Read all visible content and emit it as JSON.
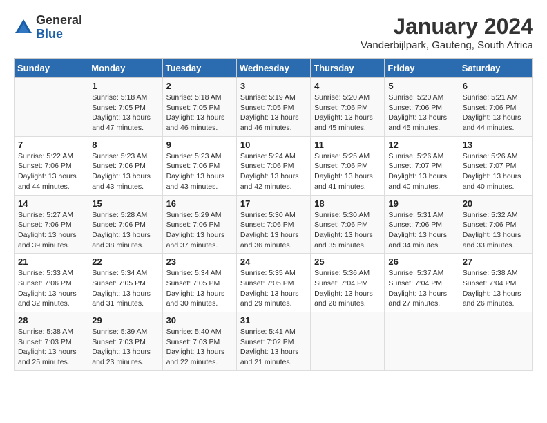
{
  "header": {
    "logo_general": "General",
    "logo_blue": "Blue",
    "month_title": "January 2024",
    "location": "Vanderbijlpark, Gauteng, South Africa"
  },
  "days_of_week": [
    "Sunday",
    "Monday",
    "Tuesday",
    "Wednesday",
    "Thursday",
    "Friday",
    "Saturday"
  ],
  "weeks": [
    [
      {
        "day": "",
        "info": ""
      },
      {
        "day": "1",
        "info": "Sunrise: 5:18 AM\nSunset: 7:05 PM\nDaylight: 13 hours and 47 minutes."
      },
      {
        "day": "2",
        "info": "Sunrise: 5:18 AM\nSunset: 7:05 PM\nDaylight: 13 hours and 46 minutes."
      },
      {
        "day": "3",
        "info": "Sunrise: 5:19 AM\nSunset: 7:05 PM\nDaylight: 13 hours and 46 minutes."
      },
      {
        "day": "4",
        "info": "Sunrise: 5:20 AM\nSunset: 7:06 PM\nDaylight: 13 hours and 45 minutes."
      },
      {
        "day": "5",
        "info": "Sunrise: 5:20 AM\nSunset: 7:06 PM\nDaylight: 13 hours and 45 minutes."
      },
      {
        "day": "6",
        "info": "Sunrise: 5:21 AM\nSunset: 7:06 PM\nDaylight: 13 hours and 44 minutes."
      }
    ],
    [
      {
        "day": "7",
        "info": "Sunrise: 5:22 AM\nSunset: 7:06 PM\nDaylight: 13 hours and 44 minutes."
      },
      {
        "day": "8",
        "info": "Sunrise: 5:23 AM\nSunset: 7:06 PM\nDaylight: 13 hours and 43 minutes."
      },
      {
        "day": "9",
        "info": "Sunrise: 5:23 AM\nSunset: 7:06 PM\nDaylight: 13 hours and 43 minutes."
      },
      {
        "day": "10",
        "info": "Sunrise: 5:24 AM\nSunset: 7:06 PM\nDaylight: 13 hours and 42 minutes."
      },
      {
        "day": "11",
        "info": "Sunrise: 5:25 AM\nSunset: 7:06 PM\nDaylight: 13 hours and 41 minutes."
      },
      {
        "day": "12",
        "info": "Sunrise: 5:26 AM\nSunset: 7:07 PM\nDaylight: 13 hours and 40 minutes."
      },
      {
        "day": "13",
        "info": "Sunrise: 5:26 AM\nSunset: 7:07 PM\nDaylight: 13 hours and 40 minutes."
      }
    ],
    [
      {
        "day": "14",
        "info": "Sunrise: 5:27 AM\nSunset: 7:06 PM\nDaylight: 13 hours and 39 minutes."
      },
      {
        "day": "15",
        "info": "Sunrise: 5:28 AM\nSunset: 7:06 PM\nDaylight: 13 hours and 38 minutes."
      },
      {
        "day": "16",
        "info": "Sunrise: 5:29 AM\nSunset: 7:06 PM\nDaylight: 13 hours and 37 minutes."
      },
      {
        "day": "17",
        "info": "Sunrise: 5:30 AM\nSunset: 7:06 PM\nDaylight: 13 hours and 36 minutes."
      },
      {
        "day": "18",
        "info": "Sunrise: 5:30 AM\nSunset: 7:06 PM\nDaylight: 13 hours and 35 minutes."
      },
      {
        "day": "19",
        "info": "Sunrise: 5:31 AM\nSunset: 7:06 PM\nDaylight: 13 hours and 34 minutes."
      },
      {
        "day": "20",
        "info": "Sunrise: 5:32 AM\nSunset: 7:06 PM\nDaylight: 13 hours and 33 minutes."
      }
    ],
    [
      {
        "day": "21",
        "info": "Sunrise: 5:33 AM\nSunset: 7:06 PM\nDaylight: 13 hours and 32 minutes."
      },
      {
        "day": "22",
        "info": "Sunrise: 5:34 AM\nSunset: 7:05 PM\nDaylight: 13 hours and 31 minutes."
      },
      {
        "day": "23",
        "info": "Sunrise: 5:34 AM\nSunset: 7:05 PM\nDaylight: 13 hours and 30 minutes."
      },
      {
        "day": "24",
        "info": "Sunrise: 5:35 AM\nSunset: 7:05 PM\nDaylight: 13 hours and 29 minutes."
      },
      {
        "day": "25",
        "info": "Sunrise: 5:36 AM\nSunset: 7:04 PM\nDaylight: 13 hours and 28 minutes."
      },
      {
        "day": "26",
        "info": "Sunrise: 5:37 AM\nSunset: 7:04 PM\nDaylight: 13 hours and 27 minutes."
      },
      {
        "day": "27",
        "info": "Sunrise: 5:38 AM\nSunset: 7:04 PM\nDaylight: 13 hours and 26 minutes."
      }
    ],
    [
      {
        "day": "28",
        "info": "Sunrise: 5:38 AM\nSunset: 7:03 PM\nDaylight: 13 hours and 25 minutes."
      },
      {
        "day": "29",
        "info": "Sunrise: 5:39 AM\nSunset: 7:03 PM\nDaylight: 13 hours and 23 minutes."
      },
      {
        "day": "30",
        "info": "Sunrise: 5:40 AM\nSunset: 7:03 PM\nDaylight: 13 hours and 22 minutes."
      },
      {
        "day": "31",
        "info": "Sunrise: 5:41 AM\nSunset: 7:02 PM\nDaylight: 13 hours and 21 minutes."
      },
      {
        "day": "",
        "info": ""
      },
      {
        "day": "",
        "info": ""
      },
      {
        "day": "",
        "info": ""
      }
    ]
  ]
}
